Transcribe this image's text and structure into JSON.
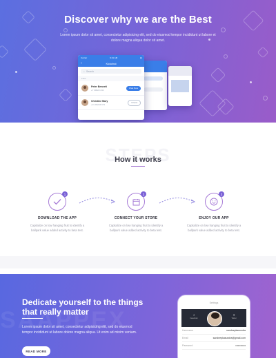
{
  "hero": {
    "title": "Discover why we are the Best",
    "subtitle": "Lorem ipsum dolor sit amet, consectetur adipisicing elit, sed do eiusmod tempor incididunt ut labore et dolore magna aliqua dolor sit amet.",
    "phone": {
      "carrier": "Carrier",
      "time": "9:41 AM",
      "title": "Kickchat",
      "search_placeholder": "Search",
      "section": "Favs",
      "contacts": [
        {
          "name": "Peter Bennett",
          "phone": "+7 99823 234",
          "action": "Chat Now"
        },
        {
          "name": "Christine Mary",
          "phone": "+31 99234 674",
          "action": "Friend"
        }
      ]
    }
  },
  "how": {
    "bg_word": "STEPS",
    "title": "How it works",
    "steps": [
      {
        "num": "1",
        "title": "DOWNLOAD THE APP",
        "desc": "Capitalize on low hanging fruit to identify a ballpark value added activity to beta test.",
        "icon": "check-icon"
      },
      {
        "num": "2",
        "title": "CONNECT YOUR STORE",
        "desc": "Capitalize on low hanging fruit to identify a ballpark value added activity to beta test.",
        "icon": "calendar-icon"
      },
      {
        "num": "3",
        "title": "ENJOY OUR APP",
        "desc": "Capitalize on low hanging fruit to identify a ballpark value added activity to beta test.",
        "icon": "smile-icon"
      }
    ]
  },
  "cta": {
    "bg_word": "SAAPPEX",
    "title": "Dedicate yourself to the things that really matter",
    "text": "Lorem ipsum dolor sit amet, consectetur adipisicing elit, sed do eiusmod tempor incididunt ut labore dolore magna aliqua. Ut enim ad minim veniam.",
    "button": "READ MORE",
    "phone": {
      "top": "Settings",
      "social_left": "f",
      "social_left_label": "Facebook",
      "social_right": "🐦",
      "social_right_label": "Twitter",
      "rows": [
        {
          "label": "Username",
          "value": "sandeepkasundra"
        },
        {
          "label": "Email",
          "value": "sandeepkasundra@gmail.com"
        },
        {
          "label": "Password",
          "value": "••••••••••••"
        }
      ]
    }
  },
  "colors": {
    "accent": "#7a61d6",
    "hero_start": "#5b6fe0",
    "hero_end": "#9a5cc9"
  }
}
